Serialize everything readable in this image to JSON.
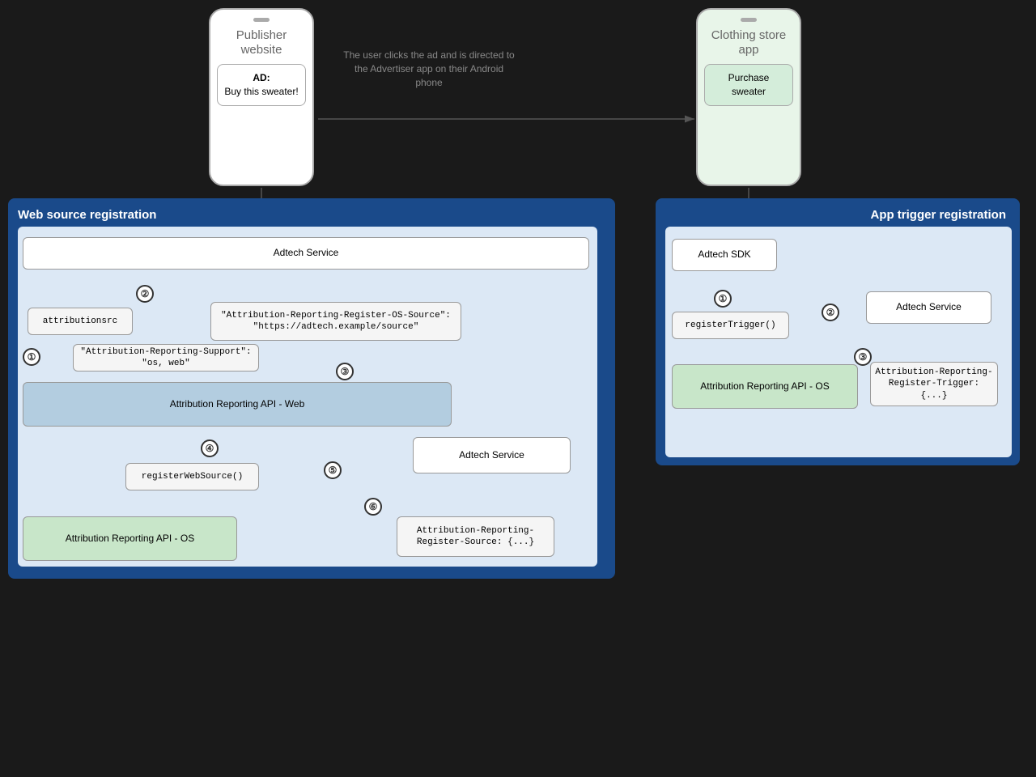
{
  "publisher_phone": {
    "title": "Publisher website",
    "ad_label": "AD:",
    "ad_text": "Buy this sweater!"
  },
  "clothing_phone": {
    "title": "Clothing store app",
    "content": "Purchase sweater"
  },
  "arrow_label": "The user clicks the ad and is directed to the Advertiser app on their Android phone",
  "left_panel": {
    "title": "Web source registration",
    "adtech_service_top": "Adtech Service",
    "attribution_src": "attributionsrc",
    "header_response": "\"Attribution-Reporting-Register-OS-Source\": \"https://adtech.example/source\"",
    "support_header": "\"Attribution-Reporting-Support\": \"os, web\"",
    "attribution_api_web": "Attribution Reporting API - Web",
    "register_web_source": "registerWebSource()",
    "adtech_service_bottom": "Adtech Service",
    "attribution_register_source": "Attribution-Reporting-Register-Source: {...}",
    "attribution_api_os": "Attribution Reporting API - OS",
    "step2": "②",
    "step3": "③",
    "step1": "①",
    "step4": "④",
    "step5": "⑤",
    "step6": "⑥"
  },
  "right_panel": {
    "title": "App trigger registration",
    "adtech_sdk": "Adtech SDK",
    "register_trigger": "registerTrigger()",
    "adtech_service": "Adtech Service",
    "attribution_register_trigger": "Attribution-Reporting-Register-Trigger: {...}",
    "attribution_api_os": "Attribution Reporting API - OS",
    "step1": "①",
    "step2": "②",
    "step3": "③"
  }
}
